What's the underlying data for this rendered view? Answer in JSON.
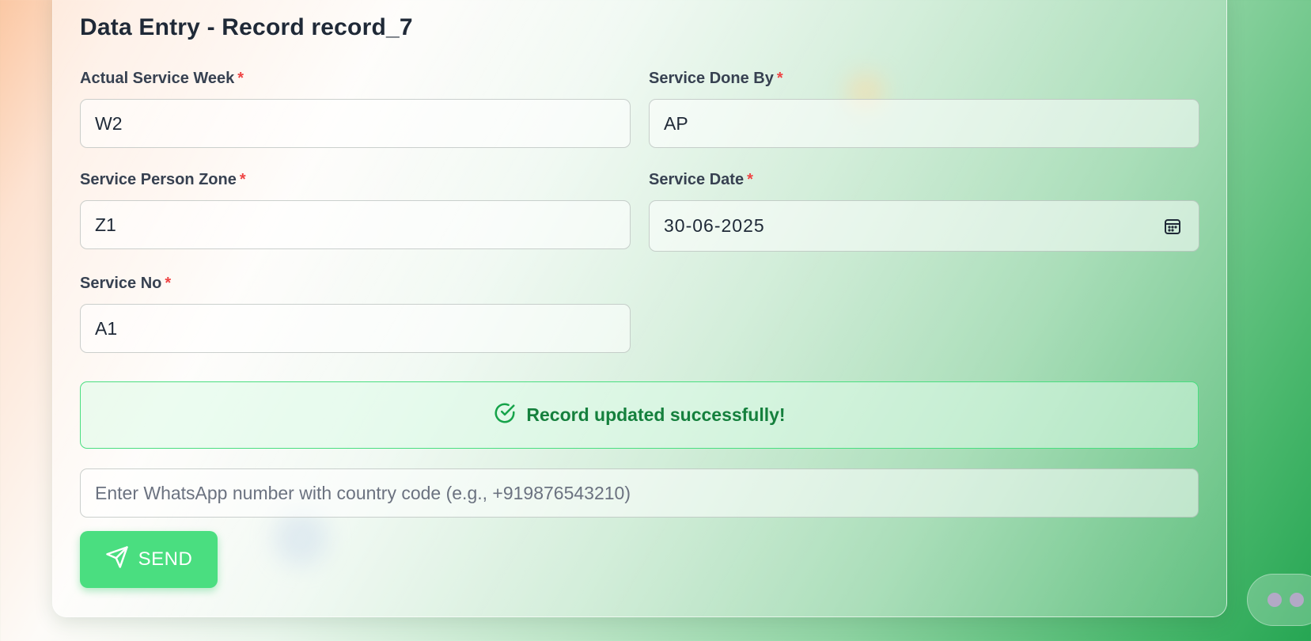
{
  "form": {
    "title": "Data Entry - Record record_7",
    "required_marker": "*",
    "fields": {
      "actual_service_week": {
        "label": "Actual Service Week",
        "value": "W2"
      },
      "service_done_by": {
        "label": "Service Done By",
        "value": "AP"
      },
      "service_person_zone": {
        "label": "Service Person Zone",
        "value": "Z1"
      },
      "service_date": {
        "label": "Service Date",
        "value": "30-06-2025"
      },
      "service_no": {
        "label": "Service No",
        "value": "A1"
      }
    }
  },
  "status": {
    "message": "Record updated successfully!",
    "color": "#15803d"
  },
  "whatsapp": {
    "placeholder": "Enter WhatsApp number with country code (e.g., +919876543210)",
    "value": ""
  },
  "send_button": {
    "label": "SEND",
    "color": "#4ade80"
  },
  "icons": {
    "status": "check-circle-icon",
    "date": "calendar-icon",
    "send": "send-icon",
    "chat": "chat-dots-icon"
  },
  "colors": {
    "required": "#ef4444",
    "accent": "#4ade80"
  }
}
